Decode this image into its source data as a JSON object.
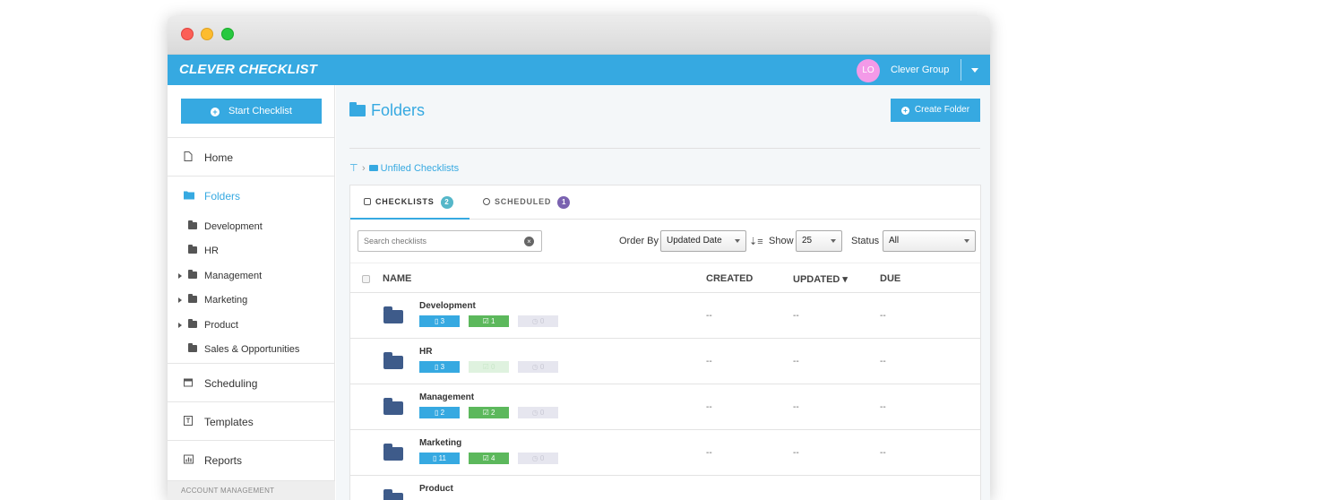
{
  "app": {
    "logo": "CLEVER CHECKLIST",
    "avatar_initials": "LO",
    "org_name": "Clever Group"
  },
  "sidebar": {
    "start_button": "Start Checklist",
    "items": [
      {
        "label": "Home",
        "icon": "file-icon"
      },
      {
        "label": "Folders",
        "icon": "folder-icon"
      },
      {
        "label": "Scheduling",
        "icon": "calendar-icon"
      },
      {
        "label": "Templates",
        "icon": "template-icon"
      },
      {
        "label": "Reports",
        "icon": "bar-chart-icon"
      }
    ],
    "folders": [
      {
        "label": "Development",
        "expandable": false
      },
      {
        "label": "HR",
        "expandable": false
      },
      {
        "label": "Management",
        "expandable": true
      },
      {
        "label": "Marketing",
        "expandable": true
      },
      {
        "label": "Product",
        "expandable": true
      },
      {
        "label": "Sales & Opportunities",
        "expandable": false
      }
    ],
    "account_section": "ACCOUNT MANAGEMENT"
  },
  "main": {
    "title": "Folders",
    "create_button": "Create Folder",
    "breadcrumb": {
      "current": "Unfiled Checklists"
    },
    "tabs": [
      {
        "label": "CHECKLISTS",
        "count": "2"
      },
      {
        "label": "SCHEDULED",
        "count": "1"
      }
    ],
    "search": {
      "placeholder": "Search checklists"
    },
    "order_by": {
      "label": "Order By",
      "value": "Updated Date"
    },
    "show": {
      "label": "Show",
      "value": "25"
    },
    "status": {
      "label": "Status",
      "value": "All"
    },
    "table": {
      "headers": {
        "name": "NAME",
        "created": "CREATED",
        "updated": "UPDATED ▾",
        "due": "DUE"
      },
      "rows": [
        {
          "name": "Development",
          "docs": "3",
          "done": "1",
          "scheduled": "0",
          "created": "--",
          "updated": "--",
          "due": "--"
        },
        {
          "name": "HR",
          "docs": "3",
          "done": "0",
          "scheduled": "0",
          "created": "--",
          "updated": "--",
          "due": "--"
        },
        {
          "name": "Management",
          "docs": "2",
          "done": "2",
          "scheduled": "0",
          "created": "--",
          "updated": "--",
          "due": "--"
        },
        {
          "name": "Marketing",
          "docs": "11",
          "done": "4",
          "scheduled": "0",
          "created": "--",
          "updated": "--",
          "due": "--"
        },
        {
          "name": "Product",
          "docs": "",
          "done": "",
          "scheduled": "",
          "created": "",
          "updated": "",
          "due": ""
        }
      ]
    }
  },
  "colors": {
    "accent": "#36a9e1",
    "success": "#5cb85c",
    "folder": "#3e5b8a",
    "avatar": "#f39ae8"
  }
}
